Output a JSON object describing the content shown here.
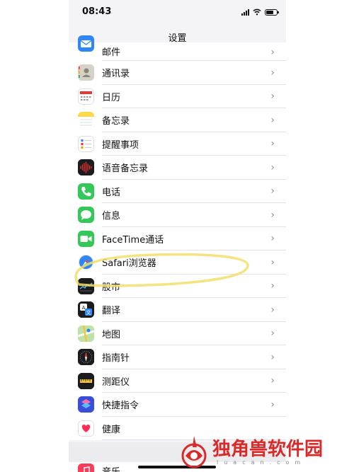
{
  "status_bar": {
    "time": "08:43",
    "battery_level": 0.6
  },
  "nav": {
    "title": "设置"
  },
  "settings_items": [
    {
      "label": "邮件",
      "icon": "mail-icon",
      "color": "#2f86f6"
    },
    {
      "label": "通讯录",
      "icon": "contacts-icon",
      "color": "#b9b4a8"
    },
    {
      "label": "日历",
      "icon": "calendar-icon",
      "color": "#ffffff"
    },
    {
      "label": "备忘录",
      "icon": "notes-icon",
      "color": "#ffd84a"
    },
    {
      "label": "提醒事项",
      "icon": "reminders-icon",
      "color": "#ffffff"
    },
    {
      "label": "语音备忘录",
      "icon": "voice-memos-icon",
      "color": "#1c1c1e"
    },
    {
      "label": "电话",
      "icon": "phone-icon",
      "color": "#34c759"
    },
    {
      "label": "信息",
      "icon": "messages-icon",
      "color": "#34c759"
    },
    {
      "label": "FaceTime通话",
      "icon": "facetime-icon",
      "color": "#34c759"
    },
    {
      "label": "Safari浏览器",
      "icon": "safari-icon",
      "color": "#ffffff"
    },
    {
      "label": "股市",
      "icon": "stocks-icon",
      "color": "#1c1c1e"
    },
    {
      "label": "翻译",
      "icon": "translate-icon",
      "color": "#1c1c1e"
    },
    {
      "label": "地图",
      "icon": "maps-icon",
      "color": "#7fcf7a"
    },
    {
      "label": "指南针",
      "icon": "compass-icon",
      "color": "#1c1c1e"
    },
    {
      "label": "测距仪",
      "icon": "measure-icon",
      "color": "#1c1c1e"
    },
    {
      "label": "快捷指令",
      "icon": "shortcuts-icon",
      "color": "#3b4ed8"
    },
    {
      "label": "健康",
      "icon": "health-icon",
      "color": "#ffffff"
    }
  ],
  "next_section": {
    "label": "音乐",
    "icon": "music-icon",
    "color": "#fa3c5a"
  },
  "chevron": "›",
  "annotation": {
    "highlight_color": "#f2df6b"
  },
  "watermark": {
    "title": "独角兽软件园",
    "subtitle": "luacan.com"
  }
}
